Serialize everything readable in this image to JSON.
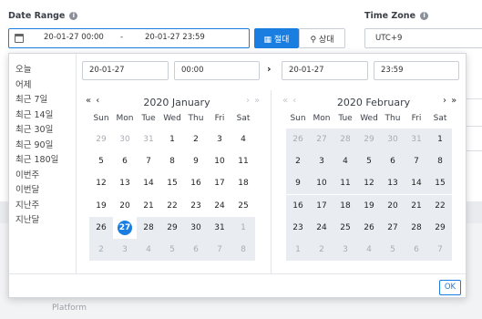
{
  "filters": {
    "date_range_label": "Date Range",
    "range_start": "20-01-27 00:00",
    "range_separator": "-",
    "range_end": "20-01-27 23:59",
    "mode_absolute": "▦ 절대",
    "mode_relative": "⚲ 상대",
    "time_zone_label": "Time Zone",
    "time_zone_value": "UTC+9",
    "info_glyph": "i"
  },
  "picker": {
    "presets": [
      "오늘",
      "어제",
      "최근 7일",
      "최근 14일",
      "최근 30일",
      "최근 90일",
      "최근 180일",
      "이번주",
      "이번달",
      "지난주",
      "지난달"
    ],
    "start_date": "20-01-27",
    "start_time": "00:00",
    "arrow": "›",
    "end_date": "20-01-27",
    "end_time": "23:59",
    "ok_label": "OK",
    "weekdays": [
      "Sun",
      "Mon",
      "Tue",
      "Wed",
      "Thu",
      "Fri",
      "Sat"
    ],
    "calendars": [
      {
        "title": "2020 January",
        "nav_prev": "« ‹",
        "nav_next": "› »",
        "days": [
          [
            "29",
            "30",
            "31",
            "1",
            "2",
            "3",
            "4"
          ],
          [
            "5",
            "6",
            "7",
            "8",
            "9",
            "10",
            "11"
          ],
          [
            "12",
            "13",
            "14",
            "15",
            "16",
            "17",
            "18"
          ],
          [
            "19",
            "20",
            "21",
            "22",
            "23",
            "24",
            "25"
          ],
          [
            "26",
            "27",
            "28",
            "29",
            "30",
            "31",
            "1"
          ],
          [
            "2",
            "3",
            "4",
            "5",
            "6",
            "7",
            "8"
          ]
        ]
      },
      {
        "title": "2020 February",
        "nav_prev": "« ‹",
        "nav_next": "› »",
        "days": [
          [
            "26",
            "27",
            "28",
            "29",
            "30",
            "31",
            "1"
          ],
          [
            "2",
            "3",
            "4",
            "5",
            "6",
            "7",
            "8"
          ],
          [
            "9",
            "10",
            "11",
            "12",
            "13",
            "14",
            "15"
          ],
          [
            "16",
            "17",
            "18",
            "19",
            "20",
            "21",
            "22"
          ],
          [
            "23",
            "24",
            "25",
            "26",
            "27",
            "28",
            "29"
          ],
          [
            "1",
            "2",
            "3",
            "4",
            "5",
            "6",
            "7"
          ]
        ]
      }
    ]
  },
  "background": {
    "platform_label": "Platform"
  },
  "colors": {
    "accent": "#1a7ee0",
    "shade": "#e9ecf0"
  }
}
